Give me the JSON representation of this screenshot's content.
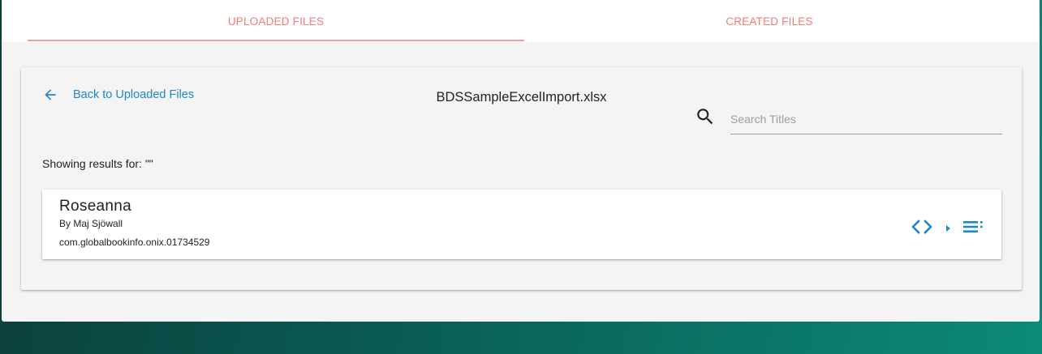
{
  "tabs": {
    "uploaded_label": "Uploaded Files",
    "created_label": "Created Files",
    "active": "uploaded"
  },
  "header": {
    "back_label": "Back to Uploaded Files",
    "file_name": "BDSSampleExcelImport.xlsx"
  },
  "search": {
    "placeholder": "Search Titles",
    "value": ""
  },
  "results": {
    "label": "Showing results for: \"\"",
    "items": [
      {
        "title": "Roseanna",
        "author": "By Maj Sjöwall",
        "record_id": "com.globalbookinfo.onix.01734529",
        "actions": [
          "code-icon",
          "expand-icon",
          "list-icon"
        ]
      }
    ]
  },
  "colors": {
    "tab_text": "#f07b7b",
    "tab_indicator": "#f2a0a0",
    "accent_blue": "#1e88c8",
    "panel_bg": "#f4f4f4"
  }
}
